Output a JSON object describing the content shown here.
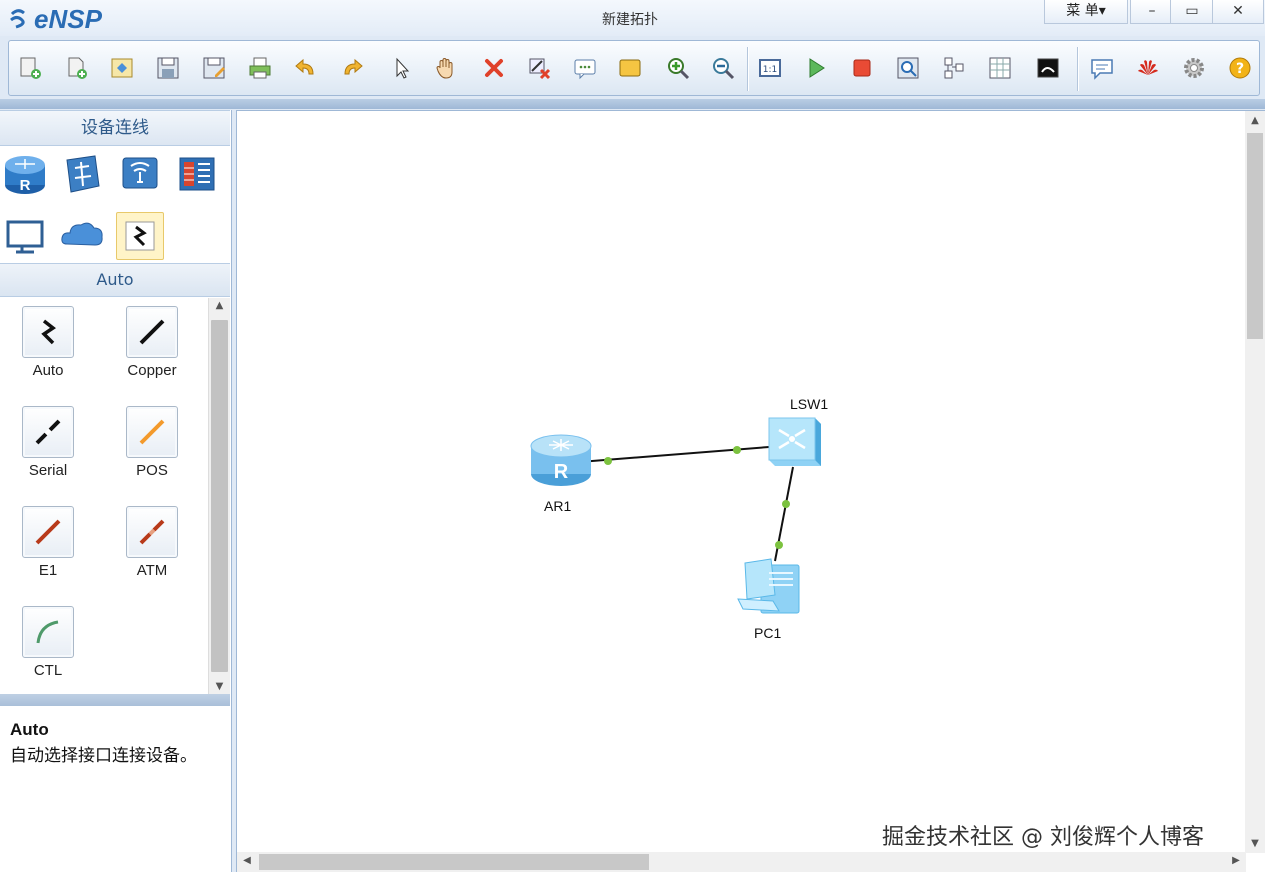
{
  "app": {
    "name": "eNSP",
    "window_title": "新建拓扑",
    "menu_label": "菜 单▾",
    "controls": {
      "minimize": "–",
      "maximize": "▭",
      "close": "✕"
    }
  },
  "toolbar": {
    "buttons": [
      "new-topology-icon",
      "new-example-icon",
      "open-icon",
      "save-icon",
      "save-as-icon",
      "print-icon",
      "undo-icon",
      "redo-icon",
      "select-icon",
      "pan-hand-icon",
      "delete-icon",
      "delete-link-icon",
      "text-note-icon",
      "area-icon",
      "zoom-in-icon",
      "zoom-out-icon",
      "fit-icon",
      "start-icon",
      "stop-icon",
      "capture-icon",
      "topology-icon",
      "grid-icon",
      "cli-icon",
      "comment-icon",
      "huawei-icon",
      "settings-icon",
      "help-icon"
    ]
  },
  "left_panel": {
    "section_title": "设备连线",
    "categories": [
      "router-icon",
      "switch-icon",
      "wireless-icon",
      "firewall-icon",
      "pc-icon",
      "cloud-icon",
      "connection-icon"
    ],
    "selected_category": "connection-icon",
    "subsection_title": "Auto",
    "cables": [
      {
        "label": "Auto",
        "color": "#111111",
        "icon": "auto-cable-icon"
      },
      {
        "label": "Copper",
        "color": "#111111",
        "icon": "copper-cable-icon"
      },
      {
        "label": "Serial",
        "color": "#111111",
        "icon": "serial-cable-icon"
      },
      {
        "label": "POS",
        "color": "#f39a2c",
        "icon": "pos-cable-icon"
      },
      {
        "label": "E1",
        "color": "#b83a1a",
        "icon": "e1-cable-icon"
      },
      {
        "label": "ATM",
        "color": "#b83a1a",
        "icon": "atm-cable-icon"
      },
      {
        "label": "CTL",
        "color": "#4f9a6a",
        "icon": "ctl-cable-icon"
      }
    ],
    "description": {
      "title": "Auto",
      "text": "自动选择接口连接设备。"
    }
  },
  "topology": {
    "nodes": [
      {
        "label": "AR1",
        "type": "router"
      },
      {
        "label": "LSW1",
        "type": "switch"
      },
      {
        "label": "PC1",
        "type": "pc"
      }
    ],
    "links": [
      {
        "from": "AR1",
        "to": "LSW1",
        "port_color": "#7cc23f"
      },
      {
        "from": "LSW1",
        "to": "PC1",
        "port_color": "#7cc23f"
      }
    ]
  },
  "watermark": "掘金技术社区 @ 刘俊辉个人博客"
}
